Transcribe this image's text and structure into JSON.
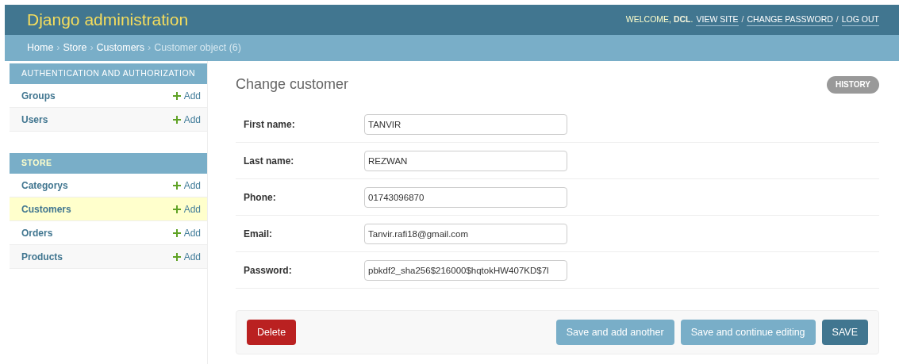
{
  "header": {
    "title": "Django administration",
    "welcome": "WELCOME,",
    "user": "DCL",
    "user_end": ".",
    "user_tools": [
      {
        "label": "VIEW SITE"
      },
      {
        "label": "CHANGE PASSWORD"
      },
      {
        "label": "LOG OUT"
      }
    ],
    "separator": "/"
  },
  "breadcrumbs": {
    "links": [
      "Home",
      "Store",
      "Customers"
    ],
    "current": "Customer object (6)",
    "separator": "›"
  },
  "sidebar": [
    {
      "title": "AUTHENTICATION AND AUTHORIZATION",
      "models": [
        {
          "name": "Groups",
          "add": "Add",
          "selected": false
        },
        {
          "name": "Users",
          "add": "Add",
          "selected": false
        }
      ]
    },
    {
      "title": "STORE",
      "models": [
        {
          "name": "Categorys",
          "add": "Add",
          "selected": false
        },
        {
          "name": "Customers",
          "add": "Add",
          "selected": true
        },
        {
          "name": "Orders",
          "add": "Add",
          "selected": false
        },
        {
          "name": "Products",
          "add": "Add",
          "selected": false
        }
      ]
    }
  ],
  "content": {
    "title": "Change customer",
    "history": "HISTORY",
    "fields": [
      {
        "label": "First name:",
        "value": "TANVIR"
      },
      {
        "label": "Last name:",
        "value": "REZWAN"
      },
      {
        "label": "Phone:",
        "value": "01743096870"
      },
      {
        "label": "Email:",
        "value": "Tanvir.rafi18@gmail.com"
      },
      {
        "label": "Password:",
        "value": "pbkdf2_sha256$216000$hqtokHW407KD$7l"
      }
    ],
    "delete": "Delete",
    "actions": [
      {
        "label": "Save and add another",
        "kind": "secondary"
      },
      {
        "label": "Save and continue editing",
        "kind": "secondary"
      },
      {
        "label": "SAVE",
        "kind": "primary"
      }
    ]
  }
}
